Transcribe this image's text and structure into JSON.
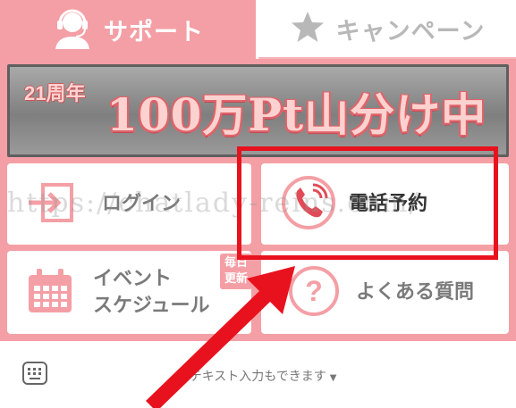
{
  "tabs": {
    "support": {
      "label": "サポート",
      "icon": "operator-headset-icon"
    },
    "campaign": {
      "label": "キャンペーン",
      "icon": "star-icon"
    }
  },
  "banner": {
    "anniversary": "21周年",
    "headline": "100万Pt山分け中"
  },
  "menu": {
    "login": {
      "label": "ログイン",
      "icon": "login-arrow-icon"
    },
    "phone": {
      "label": "電話予約",
      "icon": "phone-icon"
    },
    "event": {
      "label_line1": "イベント",
      "label_line2": "スケジュール",
      "icon": "calendar-icon",
      "badge_line1": "毎日",
      "badge_line2": "更新"
    },
    "faq": {
      "label": "よくある質問",
      "icon": "question-icon"
    }
  },
  "input": {
    "hint": "←テキスト入力もできます",
    "icon": "keyboard-icon"
  },
  "watermark": "https://chatlady-reins.com/",
  "colors": {
    "accent_pink": "#f49fa5",
    "highlight_red": "#e8121e",
    "arrow_red": "#e8121e"
  }
}
